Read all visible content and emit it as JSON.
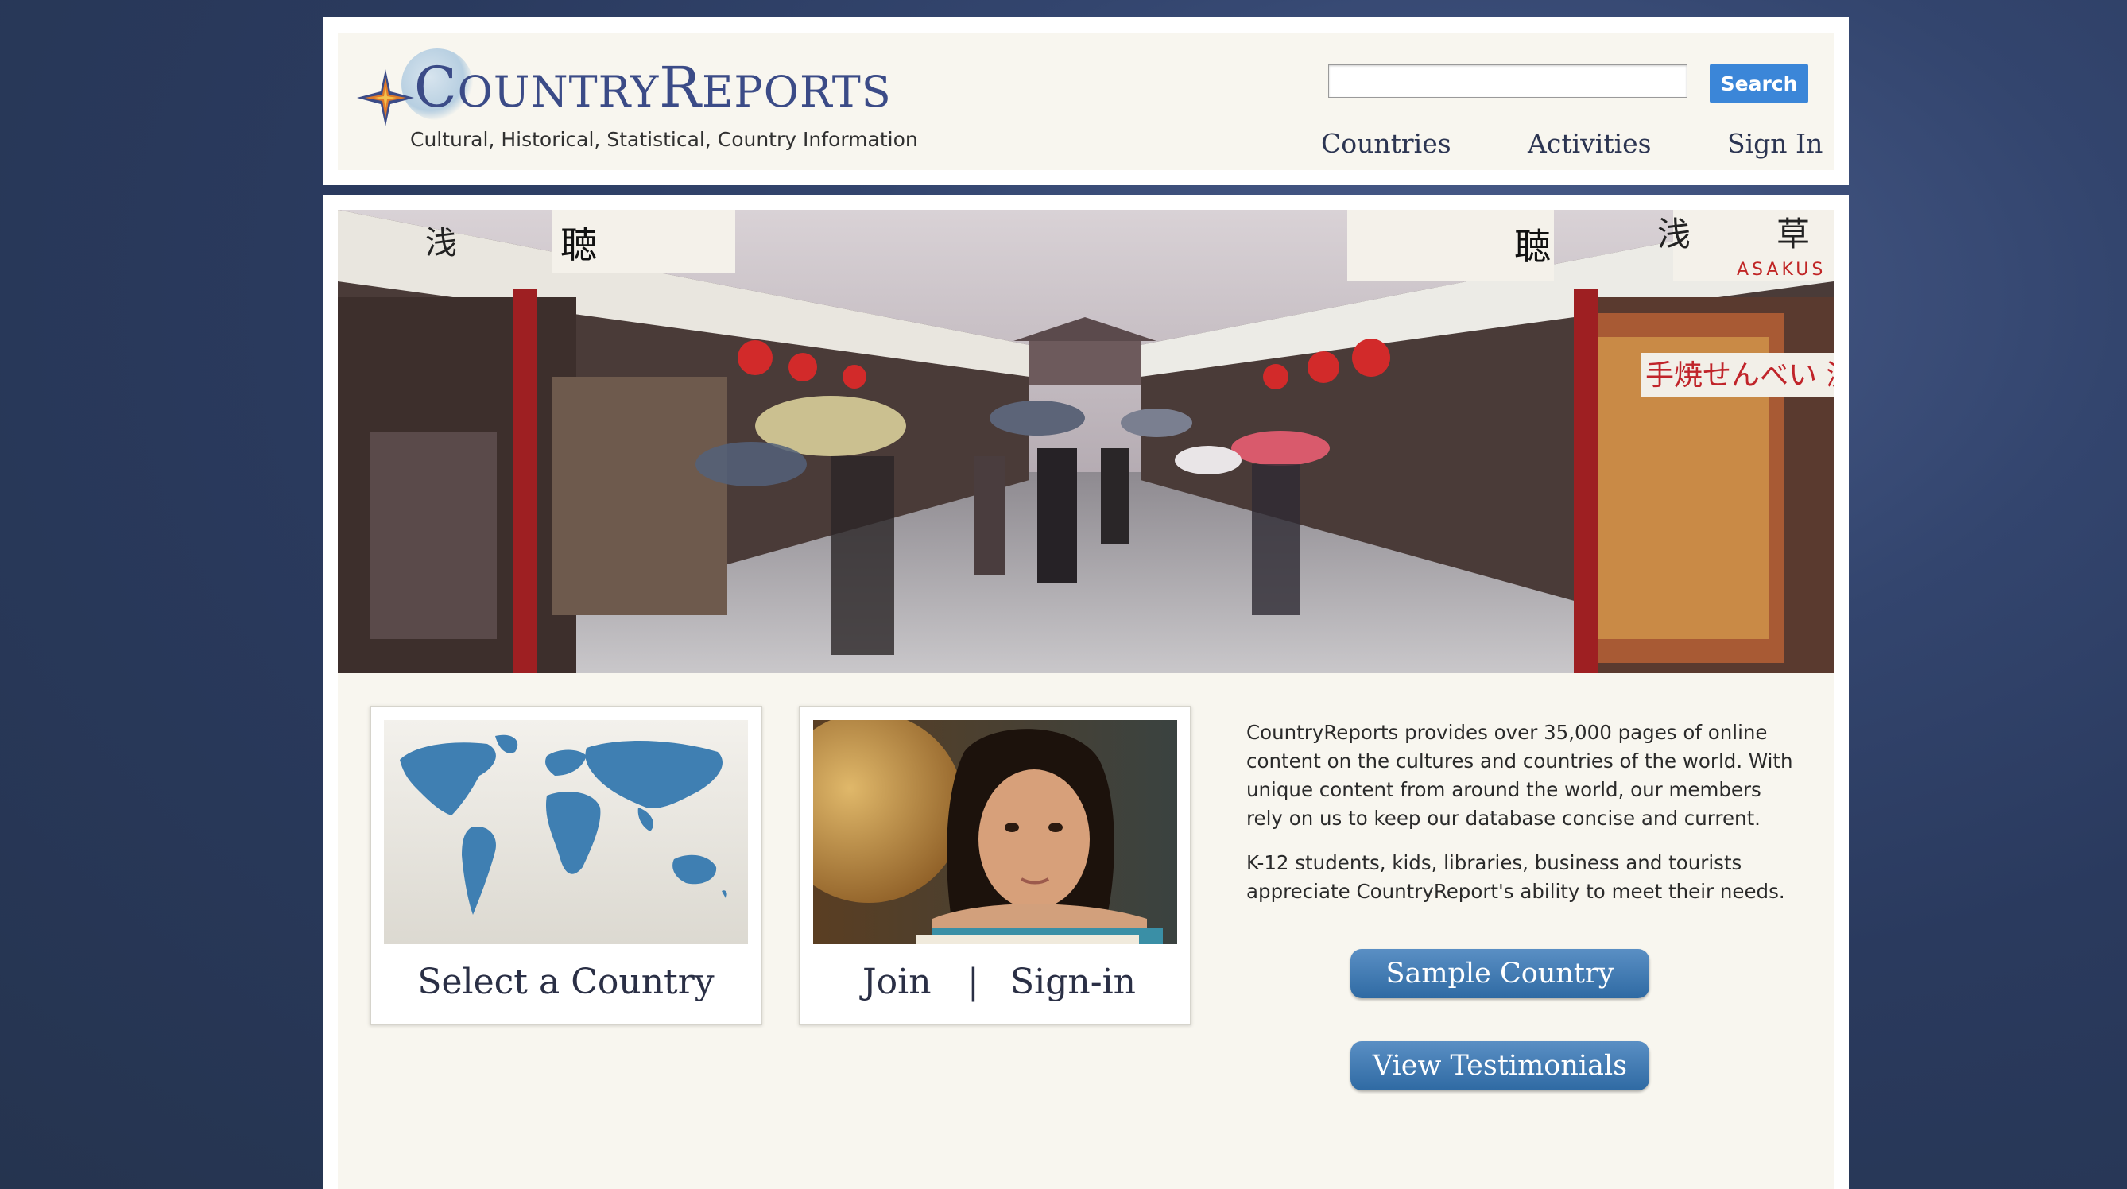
{
  "header": {
    "logo_text": "COUNTRYREPORTS",
    "tagline": "Cultural, Historical, Statistical, Country Information",
    "search": {
      "value": "",
      "placeholder": "",
      "button_label": "Search"
    },
    "nav": [
      "Countries",
      "Activities",
      "Sign In"
    ]
  },
  "hero": {
    "signs": [
      "浅",
      "聴",
      "浅",
      "草",
      "聴",
      "ASAKUS",
      "手焼せんべい 濃"
    ],
    "icon": "street-market-photo"
  },
  "cards": {
    "select_country": {
      "label": "Select a Country",
      "image_icon": "world-map"
    },
    "join_signin": {
      "join_label": "Join",
      "separator": "|",
      "signin_label": "Sign-in",
      "image_icon": "girl-with-globe"
    }
  },
  "description": {
    "paragraphs": [
      "CountryReports provides over 35,000 pages of online content on the cultures and countries of the world. With unique content from around the world, our members rely on us to keep our database concise and current.",
      "K-12 students, kids, libraries, business and tourists appreciate CountryReport's ability to meet their needs."
    ]
  },
  "buttons": {
    "sample_country": "Sample Country",
    "view_testimonials": "View Testimonials"
  },
  "colors": {
    "brand_blue": "#3b4b87",
    "search_blue": "#3b86d8",
    "pill_blue": "#2f6aa3",
    "page_bg": "#2a3a5e"
  }
}
